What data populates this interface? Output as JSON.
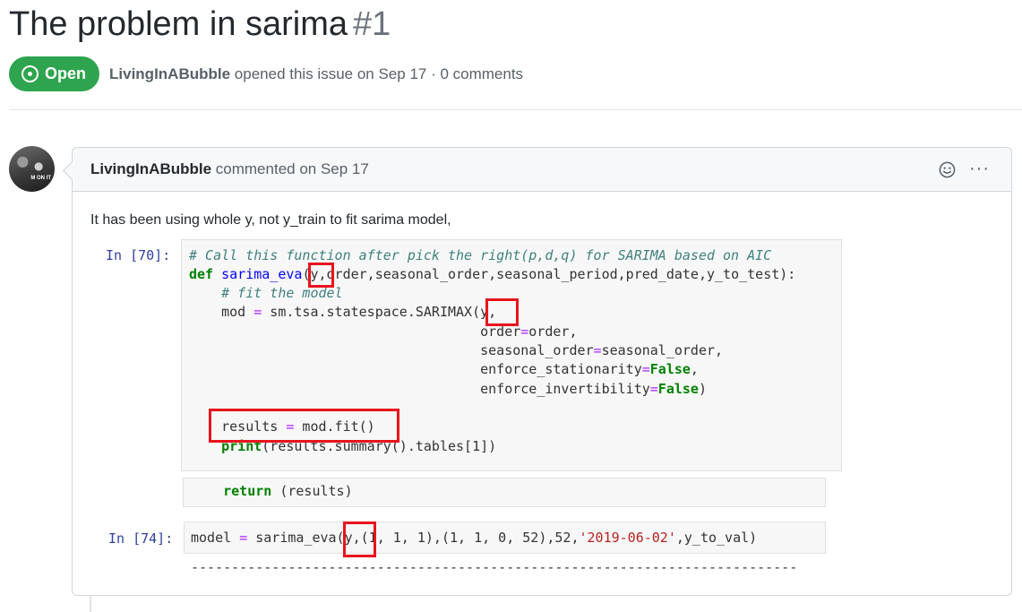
{
  "issue": {
    "title": "The problem in sarima",
    "number": "#1",
    "state": "Open",
    "author": "LivingInABubble",
    "meta_suffix": "opened this issue on Sep 17 · 0 comments"
  },
  "comment": {
    "author": "LivingInABubble",
    "action": "commented on Sep 17",
    "avatar_text": "M ON IT",
    "body": "It has been using whole y, not y_train to fit sarima model,",
    "icons": {
      "emoji": "smiley-icon",
      "more": "kebab-horizontal-icon"
    },
    "more_glyph": "···"
  },
  "notebook": {
    "cell1": {
      "prompt": "In [70]:",
      "lines": [
        "# Call this function after pick the right(p,d,q) for SARIMA based on AIC",
        "def sarima_eva(y,order,seasonal_order,seasonal_period,pred_date,y_to_test):",
        "    # fit the model",
        "    mod = sm.tsa.statespace.SARIMAX(y,",
        "                                    order=order,",
        "                                    seasonal_order=seasonal_order,",
        "                                    enforce_stationarity=False,",
        "                                    enforce_invertibility=False)",
        "",
        "    results = mod.fit()",
        "    print(results.summary().tables[1])"
      ],
      "return_line": "    return (results)"
    },
    "cell2": {
      "prompt": "In [74]:",
      "code": "model = sarima_eva(y,(1, 1, 1),(1, 1, 0, 52),52,'2019-06-02',y_to_val)",
      "output": "---------------------------------------------------------------------------"
    }
  },
  "colors": {
    "open_green": "#2ea44f",
    "highlight_red": "#e8141c",
    "prompt_blue": "#303f9f",
    "keyword_green": "#008000",
    "string_red": "#ba2121"
  }
}
